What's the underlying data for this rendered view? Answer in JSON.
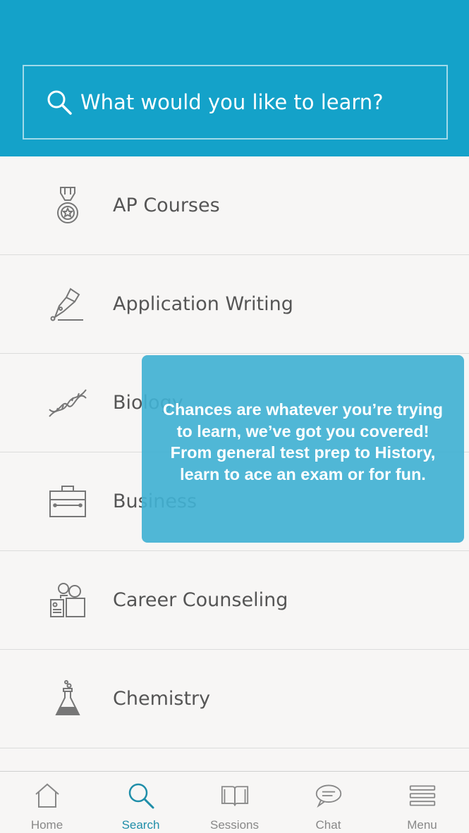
{
  "search": {
    "placeholder": "What would you like to learn?"
  },
  "categories": [
    {
      "label": "AP Courses",
      "icon": "medal-icon"
    },
    {
      "label": "Application Writing",
      "icon": "pen-nib-icon"
    },
    {
      "label": "Biology",
      "icon": "dna-icon"
    },
    {
      "label": "Business",
      "icon": "briefcase-icon"
    },
    {
      "label": "Career Counseling",
      "icon": "people-resume-icon"
    },
    {
      "label": "Chemistry",
      "icon": "flask-icon"
    }
  ],
  "tooltip": {
    "text": "Chances are whatever you’re trying to learn, we’ve got you covered!  From general test prep to History, learn to ace an exam or for fun."
  },
  "tabs": [
    {
      "label": "Home",
      "icon": "home-icon",
      "active": false
    },
    {
      "label": "Search",
      "icon": "search-icon",
      "active": true
    },
    {
      "label": "Sessions",
      "icon": "book-icon",
      "active": false
    },
    {
      "label": "Chat",
      "icon": "chat-bubble-icon",
      "active": false
    },
    {
      "label": "Menu",
      "icon": "hamburger-menu-icon",
      "active": false
    }
  ],
  "colors": {
    "header": "#14a2c9",
    "tooltip": "#41b1d2",
    "active_tab": "#1f8ea9"
  }
}
